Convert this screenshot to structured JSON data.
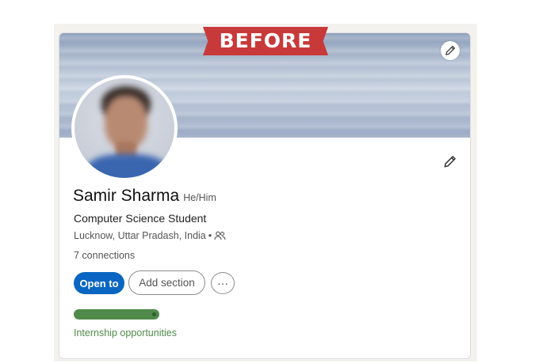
{
  "banner": {
    "label": "BEFORE"
  },
  "profile": {
    "name": "Samir Sharma",
    "pronouns": "He/Him",
    "headline": "Computer Science Student",
    "location": "Lucknow, Uttar Pradash, India",
    "separator": "•",
    "connections": "7 connections"
  },
  "actions": {
    "open_to": "Open to",
    "add_section": "Add section",
    "more": "···"
  },
  "open_to_work": {
    "text": "Internship opportunities",
    "color": "#4f8a4a"
  },
  "icons": {
    "cover_edit": "pencil-icon",
    "profile_edit": "pencil-icon",
    "connections_visibility": "people-icon"
  },
  "colors": {
    "primary": "#0a66c2",
    "banner": "#c83a3a",
    "card_border": "#dcdcdc"
  }
}
